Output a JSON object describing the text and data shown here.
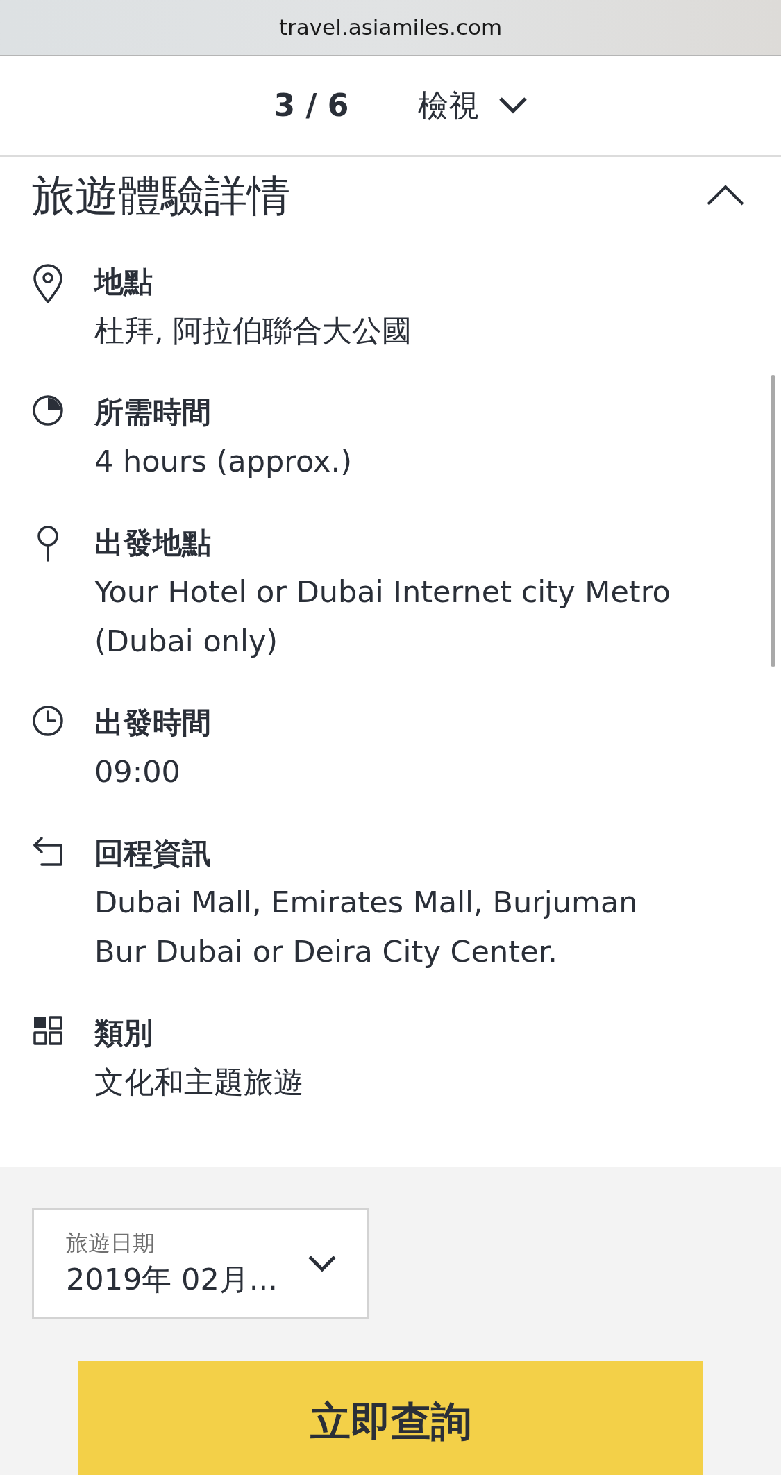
{
  "browser": {
    "url": "travel.asiamiles.com"
  },
  "pager": {
    "position": "3 / 6",
    "view_label": "檢視"
  },
  "section": {
    "title": "旅遊體驗詳情",
    "expanded": true,
    "items": [
      {
        "kind": "location",
        "label": "地點",
        "lines": [
          "杜拜, 阿拉伯聯合大公國"
        ]
      },
      {
        "kind": "duration",
        "label": "所需時間",
        "lines": [
          "4 hours (approx.)"
        ]
      },
      {
        "kind": "start",
        "label": "出發地點",
        "lines": [
          "Your Hotel or Dubai Internet city Metro",
          "(Dubai only)"
        ]
      },
      {
        "kind": "time",
        "label": "出發時間",
        "lines": [
          "09:00"
        ]
      },
      {
        "kind": "return",
        "label": "回程資訊",
        "lines": [
          "Dubai Mall, Emirates Mall, Burjuman",
          "Bur Dubai or Deira City Center."
        ]
      },
      {
        "kind": "category",
        "label": "類別",
        "lines": [
          "文化和主題旅遊"
        ]
      }
    ]
  },
  "date_field": {
    "label": "旅遊日期",
    "value": "2019年 02月..."
  },
  "search_button": "立即查詢"
}
